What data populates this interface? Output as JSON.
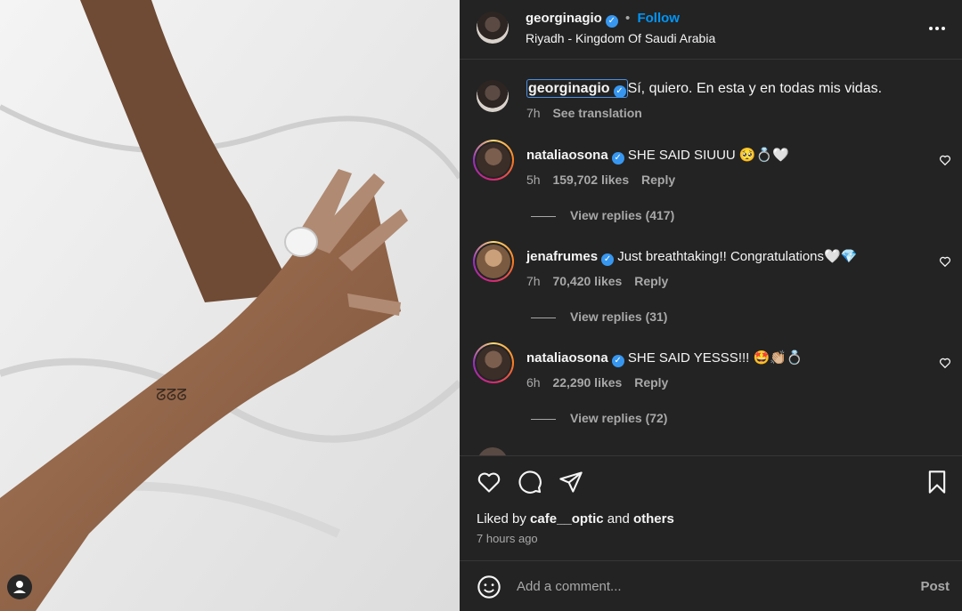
{
  "post": {
    "author": "georginagio",
    "follow_label": "Follow",
    "location": "Riyadh - Kingdom Of Saudi Arabia",
    "caption_author": "georginagio",
    "caption_text": "Sí, quiero. En esta y en todas mis vidas.",
    "caption_time": "7h",
    "see_translation": "See translation"
  },
  "comments": [
    {
      "user": "nataliaosona",
      "text": "SHE SAID SIUUU 🥺💍🤍",
      "time": "5h",
      "likes": "159,702 likes",
      "reply": "Reply",
      "view_replies": "View replies (417)"
    },
    {
      "user": "jenafrumes",
      "text": "Just breathtaking!! Congratulations🤍💎",
      "time": "7h",
      "likes": "70,420 likes",
      "reply": "Reply",
      "view_replies": "View replies (31)"
    },
    {
      "user": "nataliaosona",
      "text": "SHE SAID YESSS!!! 🤩👏🏼💍",
      "time": "6h",
      "likes": "22,290 likes",
      "reply": "Reply",
      "view_replies": "View replies (72)"
    }
  ],
  "footer": {
    "liked_by_prefix": "Liked by",
    "liked_by_user": "cafe__optic",
    "liked_by_and": "and",
    "liked_by_others": "others",
    "timestamp": "7 hours ago",
    "comment_placeholder": "Add a comment...",
    "post_label": "Post"
  },
  "icons": {
    "more": "more-options-icon",
    "like": "heart-icon",
    "comment": "comment-icon",
    "share": "share-icon",
    "save": "bookmark-icon",
    "emoji": "emoji-icon",
    "user": "user-tag-icon"
  },
  "colors": {
    "follow": "#0095f6",
    "verified": "#3797f0",
    "panel_bg": "#232323"
  }
}
